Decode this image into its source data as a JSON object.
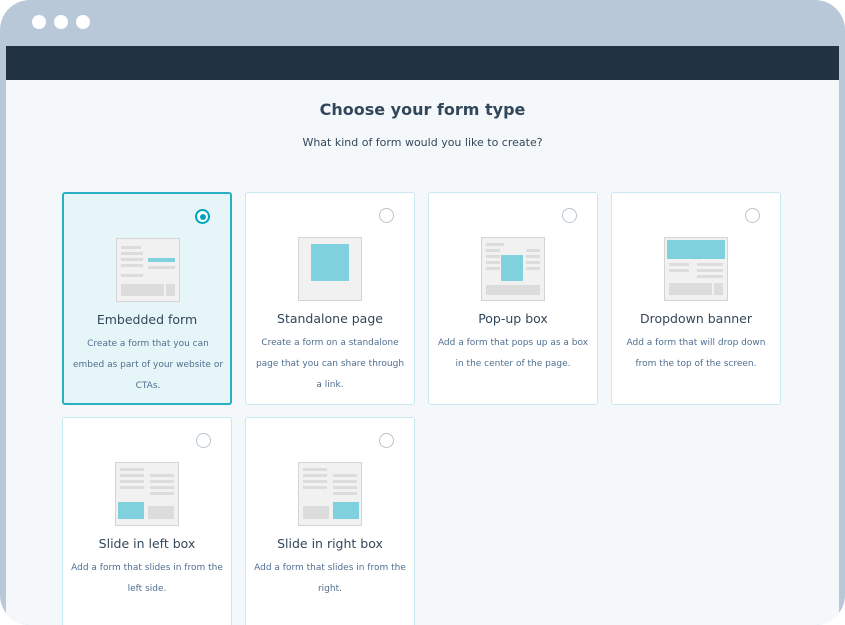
{
  "header": {
    "title": "Choose your form type",
    "subtitle": "What kind of form would you like to create?"
  },
  "colors": {
    "navbar": "#213343",
    "accent": "#00a4bd",
    "illustration_highlight": "#7fd1de",
    "selected_card_bg": "#e5f5f8"
  },
  "form_types": [
    {
      "title": "Embedded form",
      "description": "Create a form that you can embed as part of your website or CTAs.",
      "selected": true,
      "icon": "embedded-form-icon"
    },
    {
      "title": "Standalone page",
      "description": "Create a form on a standalone page that you can share through a link.",
      "selected": false,
      "icon": "standalone-page-icon"
    },
    {
      "title": "Pop-up box",
      "description": "Add a form that pops up as a box in the center of the page.",
      "selected": false,
      "icon": "popup-box-icon"
    },
    {
      "title": "Dropdown banner",
      "description": "Add a form that will drop down from the top of the screen.",
      "selected": false,
      "icon": "dropdown-banner-icon"
    },
    {
      "title": "Slide in left box",
      "description": "Add a form that slides in from the left side.",
      "selected": false,
      "icon": "slide-in-left-icon"
    },
    {
      "title": "Slide in right box",
      "description": "Add a form that slides in from the right.",
      "selected": false,
      "icon": "slide-in-right-icon"
    }
  ]
}
